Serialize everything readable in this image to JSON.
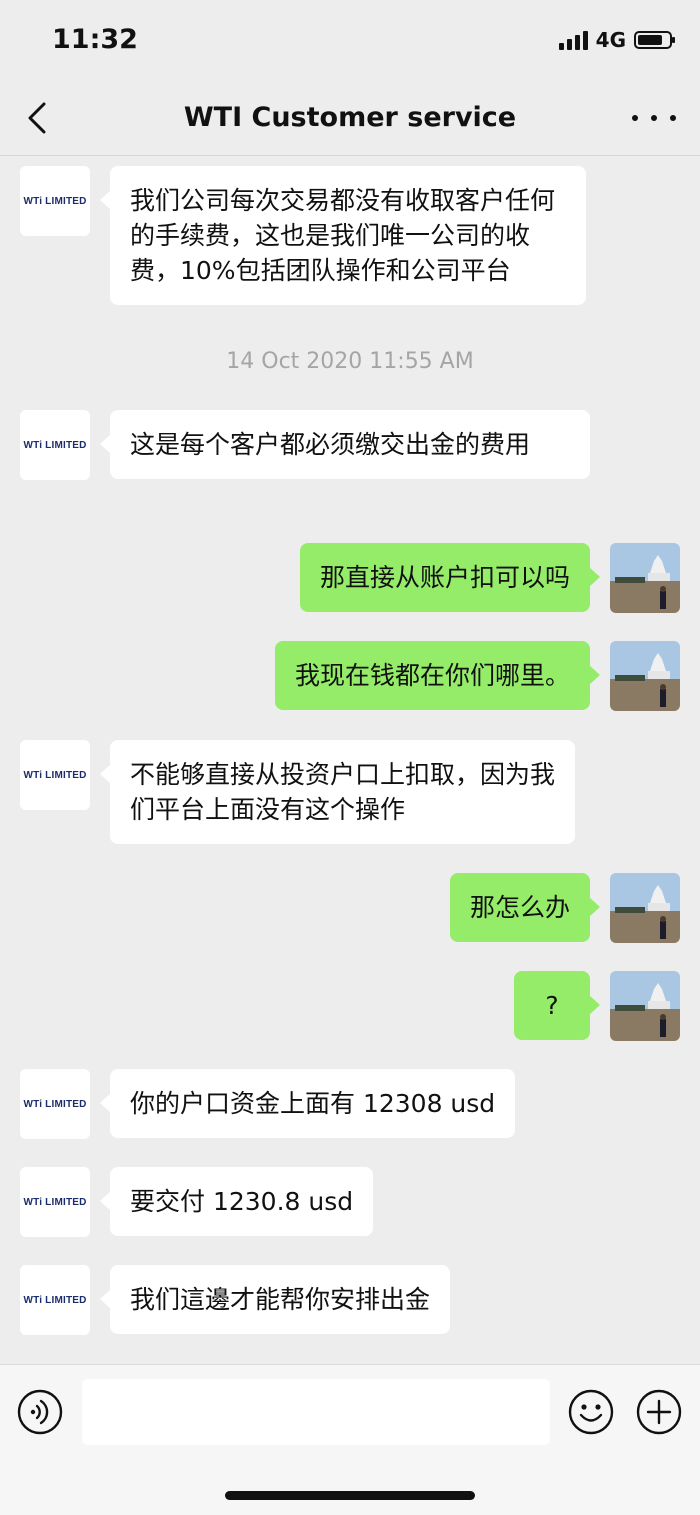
{
  "status_bar": {
    "time": "11:32",
    "network": "4G"
  },
  "header": {
    "title": "WTI Customer service"
  },
  "contact": {
    "avatar_text": "WTi LIMITED"
  },
  "messages": [
    {
      "from": "contact",
      "text": "我们公司每次交易都没有收取客户任何的手续费，这也是我们唯一公司的收费，10%包括团队操作和公司平台"
    },
    {
      "type": "timestamp",
      "text": "14 Oct 2020 11:55 AM"
    },
    {
      "from": "contact",
      "text": "这是每个客户都必须缴交出金的费用"
    },
    {
      "from": "me",
      "text": "那直接从账户扣可以吗"
    },
    {
      "from": "me",
      "text": "我现在钱都在你们哪里。"
    },
    {
      "from": "contact",
      "text": "不能够直接从投资户口上扣取，因为我们平台上面没有这个操作"
    },
    {
      "from": "me",
      "text": "那怎么办"
    },
    {
      "from": "me",
      "text": "?"
    },
    {
      "from": "contact",
      "text": "你的户口资金上面有 12308 usd"
    },
    {
      "from": "contact",
      "text": "要交付 1230.8 usd"
    },
    {
      "from": "contact",
      "text": "我们這邊才能帮你安排出金"
    }
  ],
  "input_bar": {
    "value": "",
    "placeholder": ""
  },
  "icons": {
    "back": "chevron-left-icon",
    "more": "more-dots-icon",
    "voice": "voice-icon",
    "emoji": "emoji-icon",
    "plus": "plus-icon"
  },
  "colors": {
    "sent_bubble": "#95ec69",
    "received_bubble": "#ffffff",
    "chat_background": "#ededed"
  }
}
